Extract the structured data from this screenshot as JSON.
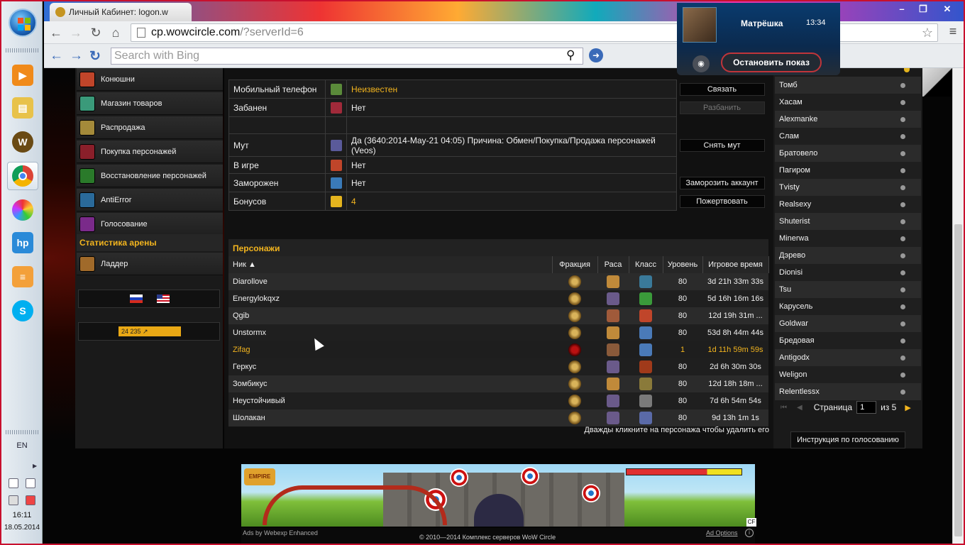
{
  "browser": {
    "tab_title": "Личный Кабинет: logon.w",
    "url_host": "cp.wowcircle.com",
    "url_path": "/?serverId=6",
    "search_placeholder": "Search with Bing"
  },
  "notification": {
    "name": "Матрёшка",
    "time": "13:34",
    "stop_label": "Остановить показ"
  },
  "sidebar": {
    "items": [
      {
        "label": "Конюшни",
        "color": "#c0452a"
      },
      {
        "label": "Магазин товаров",
        "color": "#3a9a7a"
      },
      {
        "label": "Распродажа",
        "color": "#a48a3a"
      },
      {
        "label": "Покупка персонажей",
        "color": "#8a1f2a"
      },
      {
        "label": "Восстановление персонажей",
        "color": "#2a7a2a"
      },
      {
        "label": "AntiError",
        "color": "#2a6a9a"
      },
      {
        "label": "Голосование",
        "color": "#7a2a8a"
      }
    ],
    "arena_header": "Статистика арены",
    "ladder_label": "Ладдер",
    "counter_text": "24 235"
  },
  "account": {
    "rows": [
      {
        "label": "Мобильный телефон",
        "value": "Неизвестен",
        "action": "Связать",
        "color": "#5a8a3a"
      },
      {
        "label": "Забанен",
        "value": "Нет",
        "action": "Разбанить",
        "color": "#a02a3a"
      },
      {
        "label": "",
        "value": "",
        "action": "",
        "color": "#1c1c1c"
      },
      {
        "label": "Мут",
        "value": "Да (3640:2014-May-21 04:05) Причина: Обмен/Покупка/Продажа персонажей (Veos)",
        "action": "Снять мут",
        "color": "#5a5a9a"
      },
      {
        "label": "В игре",
        "value": "Нет",
        "action": "",
        "color": "#c0452a"
      },
      {
        "label": "Заморожен",
        "value": "Нет",
        "action": "Заморозить аккаунт",
        "color": "#3a7ab8"
      },
      {
        "label": "Бонусов",
        "value": "4",
        "action": "Пожертвовать",
        "color": "#e4b41e"
      }
    ]
  },
  "characters": {
    "title": "Персонажи",
    "columns": [
      "Ник ▲",
      "Фракция",
      "Раса",
      "Класс",
      "Уровень",
      "Игровое время"
    ],
    "rows": [
      {
        "name": "Diarollove",
        "level": "80",
        "time": "3d 21h 33m 33s",
        "race_color": "#c08a3a",
        "class_color": "#3a7a9a"
      },
      {
        "name": "Energylokqxz",
        "level": "80",
        "time": "5d 16h 16m 16s",
        "race_color": "#6a5a8a",
        "class_color": "#3a9a3a"
      },
      {
        "name": "Qgib",
        "level": "80",
        "time": "12d 19h 31m ...",
        "race_color": "#a05a3a",
        "class_color": "#c0452a"
      },
      {
        "name": "Unstormx",
        "level": "80",
        "time": "53d 8h 44m 44s",
        "race_color": "#c08a3a",
        "class_color": "#4a7ab8"
      },
      {
        "name": "Zifag",
        "level": "1",
        "time": "1d 11h 59m 59s",
        "race_color": "#8a5a3a",
        "class_color": "#4a7ab8"
      },
      {
        "name": "Геркус",
        "level": "80",
        "time": "2d 6h 30m 30s",
        "race_color": "#6a5a8a",
        "class_color": "#a03a1a"
      },
      {
        "name": "Зомбикус",
        "level": "80",
        "time": "12d 18h 18m ...",
        "race_color": "#c08a3a",
        "class_color": "#8a7a3a"
      },
      {
        "name": "Неустойчивый",
        "level": "80",
        "time": "7d 6h 54m 54s",
        "race_color": "#6a5a8a",
        "class_color": "#7a7a7a"
      },
      {
        "name": "Шолакан",
        "level": "80",
        "time": "9d 13h 1m 1s",
        "race_color": "#6a5a8a",
        "class_color": "#5a6aa8"
      }
    ],
    "hint": "Дважды кликните на персонажа чтобы удалить его"
  },
  "vote_list": {
    "names": [
      "Томб",
      "Хасам",
      "Alexmanke",
      "Слам",
      "Братовело",
      "Пагиром",
      "Tvisty",
      "Realsexy",
      "Shuterist",
      "Minerwa",
      "Дэрево",
      "Dionisi",
      "Tsu",
      "Карусель",
      "Goldwar",
      "Бредовая",
      "Antigodx",
      "Weligon",
      "Relentlessx"
    ],
    "page_label": "Страница",
    "page_value": "1",
    "of_label": "из 5",
    "instruction": "Инструкция по голосованию"
  },
  "ad": {
    "logo": "EMPIRE",
    "ads_by": "Ads by Webexp Enhanced",
    "options": "Ad Options",
    "cf": "CF"
  },
  "footer": {
    "copyright": "© 2010—2014 Комплекс серверов WoW Circle"
  },
  "taskbar": {
    "lang": "EN",
    "time": "16:11",
    "date": "18.05.2014"
  }
}
